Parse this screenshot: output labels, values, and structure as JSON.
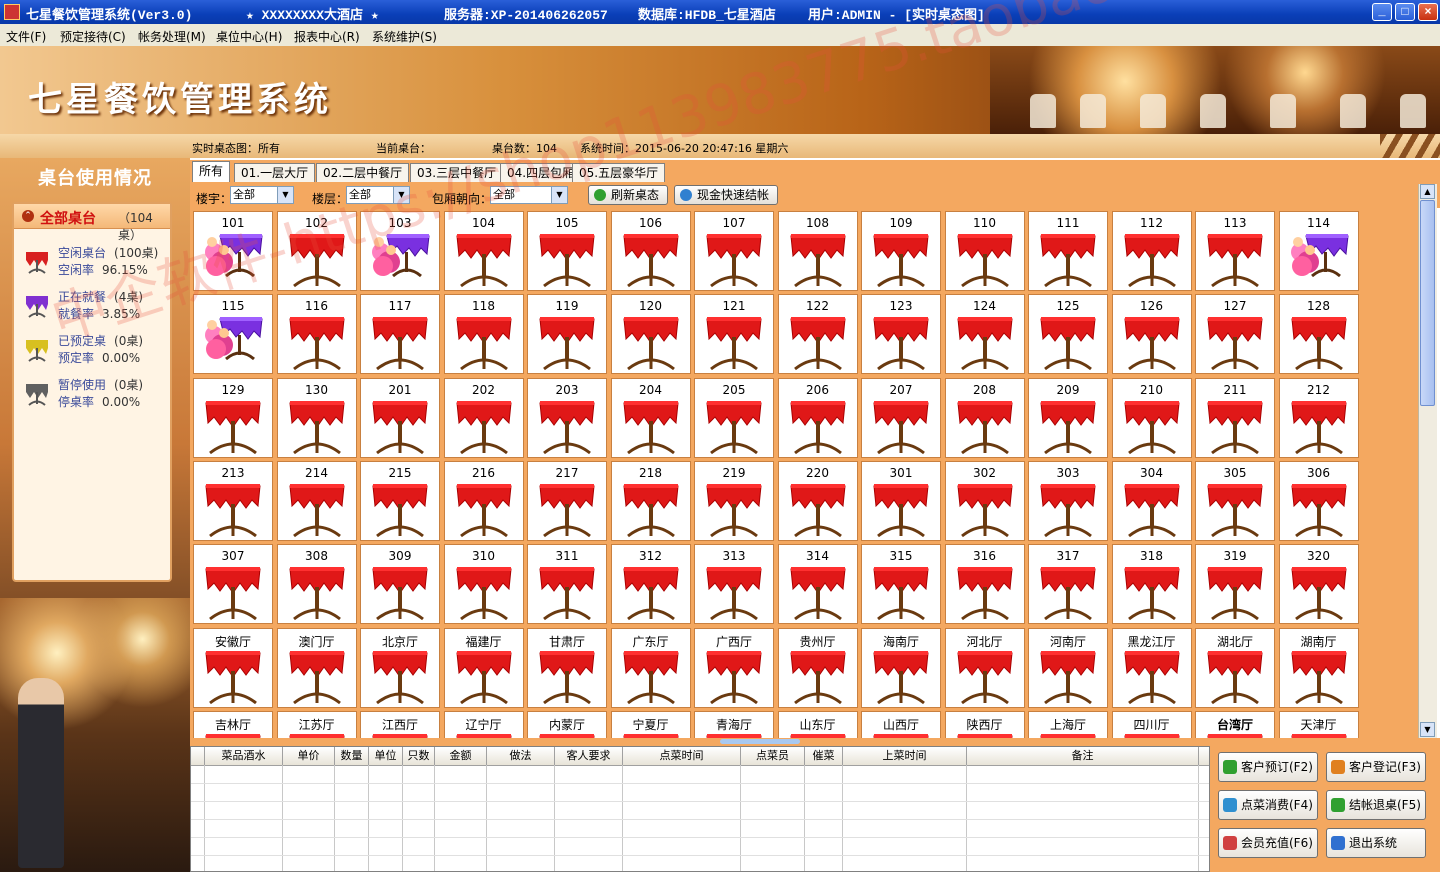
{
  "titlebar": {
    "app": "七星餐饮管理系统(Ver3.0)",
    "hotel": "★ XXXXXXXX大酒店 ★",
    "server": "服务器:XP-201406262057",
    "db": "数据库:HFDB_七星酒店",
    "user": "用户:ADMIN - [实时桌态图]",
    "min": "_",
    "max": "□",
    "close": "×"
  },
  "menu": [
    "文件(F)",
    "预定接待(C)",
    "帐务处理(M)",
    "桌位中心(H)",
    "报表中心(R)",
    "系统维护(S)"
  ],
  "banner": {
    "logo": "七星餐饮管理系统"
  },
  "info": {
    "view": "实时桌态图：所有",
    "current": "当前桌台：",
    "count": "桌台数：104",
    "time": "系统时间：2015-06-20 20:47:16 星期六"
  },
  "left": {
    "heading": "桌台使用情况",
    "all_label": "全部桌台",
    "all_count": "（104桌）",
    "stats": [
      {
        "icon": "free-table-icon",
        "name": "空闲桌台",
        "count": "(100桌)",
        "rate_label": "空闲率",
        "rate": "96.15%",
        "color": "#d82020"
      },
      {
        "icon": "dining-table-icon",
        "name": "正在就餐",
        "count": "(4桌)",
        "rate_label": "就餐率",
        "rate": "3.85%",
        "color": "#8030d0"
      },
      {
        "icon": "reserved-table-icon",
        "name": "已预定桌",
        "count": "(0桌)",
        "rate_label": "预定率",
        "rate": "0.00%",
        "color": "#d8c020"
      },
      {
        "icon": "paused-table-icon",
        "name": "暂停使用",
        "count": "(0桌)",
        "rate_label": "停桌率",
        "rate": "0.00%",
        "color": "#606060"
      }
    ]
  },
  "tabs": [
    "所有",
    "01.一层大厅",
    "02.二层中餐厅",
    "03.三层中餐厅",
    "04.四层包厢",
    "05.五层豪华厅"
  ],
  "filters": {
    "l1": "楼宇：",
    "v1": "全部",
    "l2": "楼层：",
    "v2": "全部",
    "l3": "包厢朝向：",
    "v3": "全部",
    "refresh": "刷新桌态",
    "cash": "现金快速结帐"
  },
  "tables": [
    {
      "n": "101",
      "s": "busy"
    },
    {
      "n": "102",
      "s": "free"
    },
    {
      "n": "103",
      "s": "busy"
    },
    {
      "n": "104",
      "s": "free"
    },
    {
      "n": "105",
      "s": "free"
    },
    {
      "n": "106",
      "s": "free"
    },
    {
      "n": "107",
      "s": "free"
    },
    {
      "n": "108",
      "s": "free"
    },
    {
      "n": "109",
      "s": "free"
    },
    {
      "n": "110",
      "s": "free"
    },
    {
      "n": "111",
      "s": "free"
    },
    {
      "n": "112",
      "s": "free"
    },
    {
      "n": "113",
      "s": "free"
    },
    {
      "n": "114",
      "s": "busy"
    },
    {
      "n": "115",
      "s": "busy"
    },
    {
      "n": "116",
      "s": "free"
    },
    {
      "n": "117",
      "s": "free"
    },
    {
      "n": "118",
      "s": "free"
    },
    {
      "n": "119",
      "s": "free"
    },
    {
      "n": "120",
      "s": "free"
    },
    {
      "n": "121",
      "s": "free"
    },
    {
      "n": "122",
      "s": "free"
    },
    {
      "n": "123",
      "s": "free"
    },
    {
      "n": "124",
      "s": "free"
    },
    {
      "n": "125",
      "s": "free"
    },
    {
      "n": "126",
      "s": "free"
    },
    {
      "n": "127",
      "s": "free"
    },
    {
      "n": "128",
      "s": "free"
    },
    {
      "n": "129",
      "s": "free"
    },
    {
      "n": "130",
      "s": "free"
    },
    {
      "n": "201",
      "s": "free"
    },
    {
      "n": "202",
      "s": "free"
    },
    {
      "n": "203",
      "s": "free"
    },
    {
      "n": "204",
      "s": "free"
    },
    {
      "n": "205",
      "s": "free"
    },
    {
      "n": "206",
      "s": "free"
    },
    {
      "n": "207",
      "s": "free"
    },
    {
      "n": "208",
      "s": "free"
    },
    {
      "n": "209",
      "s": "free"
    },
    {
      "n": "210",
      "s": "free"
    },
    {
      "n": "211",
      "s": "free"
    },
    {
      "n": "212",
      "s": "free"
    },
    {
      "n": "213",
      "s": "free"
    },
    {
      "n": "214",
      "s": "free"
    },
    {
      "n": "215",
      "s": "free"
    },
    {
      "n": "216",
      "s": "free"
    },
    {
      "n": "217",
      "s": "free"
    },
    {
      "n": "218",
      "s": "free"
    },
    {
      "n": "219",
      "s": "free"
    },
    {
      "n": "220",
      "s": "free"
    },
    {
      "n": "301",
      "s": "free"
    },
    {
      "n": "302",
      "s": "free"
    },
    {
      "n": "303",
      "s": "free"
    },
    {
      "n": "304",
      "s": "free"
    },
    {
      "n": "305",
      "s": "free"
    },
    {
      "n": "306",
      "s": "free"
    },
    {
      "n": "307",
      "s": "free"
    },
    {
      "n": "308",
      "s": "free"
    },
    {
      "n": "309",
      "s": "free"
    },
    {
      "n": "310",
      "s": "free"
    },
    {
      "n": "311",
      "s": "free"
    },
    {
      "n": "312",
      "s": "free"
    },
    {
      "n": "313",
      "s": "free"
    },
    {
      "n": "314",
      "s": "free"
    },
    {
      "n": "315",
      "s": "free"
    },
    {
      "n": "316",
      "s": "free"
    },
    {
      "n": "317",
      "s": "free"
    },
    {
      "n": "318",
      "s": "free"
    },
    {
      "n": "319",
      "s": "free"
    },
    {
      "n": "320",
      "s": "free"
    },
    {
      "n": "安徽厅",
      "s": "free"
    },
    {
      "n": "澳门厅",
      "s": "free"
    },
    {
      "n": "北京厅",
      "s": "free"
    },
    {
      "n": "福建厅",
      "s": "free"
    },
    {
      "n": "甘肃厅",
      "s": "free"
    },
    {
      "n": "广东厅",
      "s": "free"
    },
    {
      "n": "广西厅",
      "s": "free"
    },
    {
      "n": "贵州厅",
      "s": "free"
    },
    {
      "n": "海南厅",
      "s": "free"
    },
    {
      "n": "河北厅",
      "s": "free"
    },
    {
      "n": "河南厅",
      "s": "free"
    },
    {
      "n": "黑龙江厅",
      "s": "free"
    },
    {
      "n": "湖北厅",
      "s": "free"
    },
    {
      "n": "湖南厅",
      "s": "free"
    },
    {
      "n": "吉林厅",
      "s": "free"
    },
    {
      "n": "江苏厅",
      "s": "free"
    },
    {
      "n": "江西厅",
      "s": "free"
    },
    {
      "n": "辽宁厅",
      "s": "free"
    },
    {
      "n": "内蒙厅",
      "s": "free"
    },
    {
      "n": "宁夏厅",
      "s": "free"
    },
    {
      "n": "青海厅",
      "s": "free"
    },
    {
      "n": "山东厅",
      "s": "free"
    },
    {
      "n": "山西厅",
      "s": "free"
    },
    {
      "n": "陕西厅",
      "s": "free"
    },
    {
      "n": "上海厅",
      "s": "free"
    },
    {
      "n": "四川厅",
      "s": "free"
    },
    {
      "n": "台湾厅",
      "s": "free",
      "bold": true
    },
    {
      "n": "天津厅",
      "s": "free"
    }
  ],
  "order_columns": [
    "",
    "菜品酒水",
    "单价",
    "数量",
    "单位",
    "只数",
    "金额",
    "做法",
    "客人要求",
    "点菜时间",
    "点菜员",
    "催菜",
    "上菜时间",
    "备注"
  ],
  "actions": [
    {
      "label": "客户预订(F2)",
      "icon": "booking-icon",
      "color": "#30a030"
    },
    {
      "label": "客户登记(F3)",
      "icon": "register-icon",
      "color": "#e08020"
    },
    {
      "label": "点菜消费(F4)",
      "icon": "order-icon",
      "color": "#3090d0"
    },
    {
      "label": "结帐退桌(F5)",
      "icon": "checkout-icon",
      "color": "#30a030"
    },
    {
      "label": "会员充值(F6)",
      "icon": "member-icon",
      "color": "#d04040"
    },
    {
      "label": "退出系统",
      "icon": "exit-icon",
      "color": "#3070d0"
    }
  ],
  "watermark": "中企软件-https://shop113983775.taobao.com"
}
